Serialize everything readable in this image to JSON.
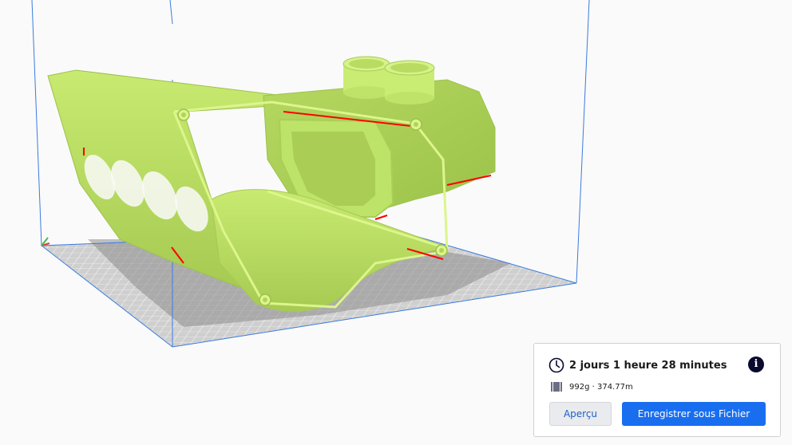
{
  "print_panel": {
    "time_estimate": "2 jours 1 heure 28 minutes",
    "material_estimate": "992g · 374.77m",
    "preview_label": "Aperçu",
    "save_label": "Enregistrer sous Fichier",
    "info_glyph": "i"
  },
  "icons": {
    "clock": "clock-icon",
    "spool": "spool-icon",
    "info": "info-icon"
  },
  "colors": {
    "model": "#c4e86a",
    "model_edge": "#dcf58c",
    "overhang": "#ff0000",
    "build_volume": "#3a7be0",
    "accent": "#196ef0",
    "info_badge": "#0a0a2e"
  }
}
